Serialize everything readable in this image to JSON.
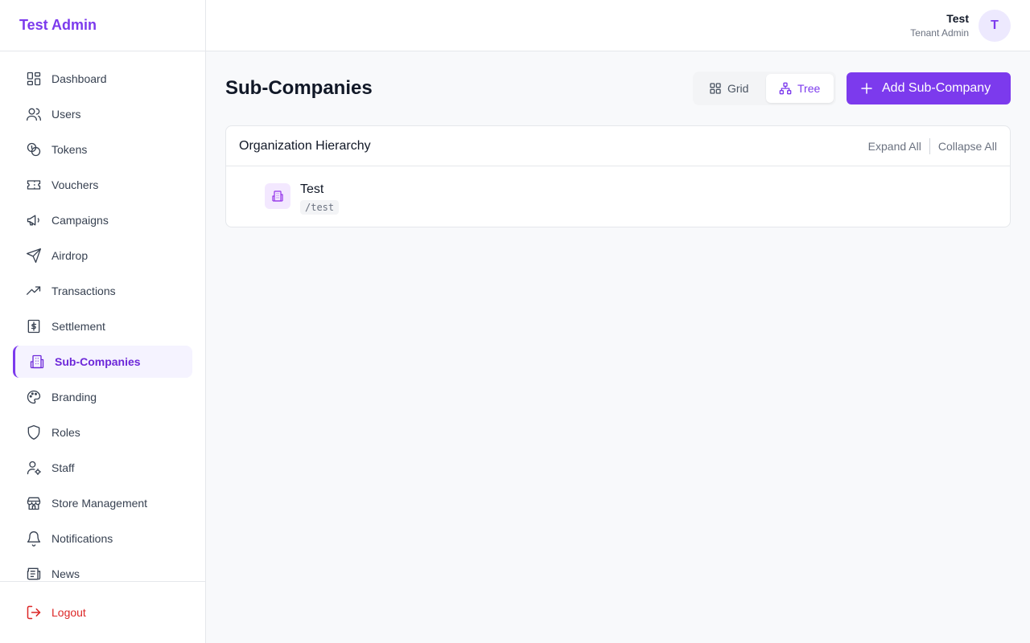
{
  "brand": "Test Admin",
  "sidebar": {
    "items": [
      {
        "label": "Dashboard",
        "icon": "dashboard-icon"
      },
      {
        "label": "Users",
        "icon": "users-icon"
      },
      {
        "label": "Tokens",
        "icon": "coins-icon"
      },
      {
        "label": "Vouchers",
        "icon": "ticket-icon"
      },
      {
        "label": "Campaigns",
        "icon": "megaphone-icon"
      },
      {
        "label": "Airdrop",
        "icon": "send-icon"
      },
      {
        "label": "Transactions",
        "icon": "trending-up-icon"
      },
      {
        "label": "Settlement",
        "icon": "dollar-receipt-icon"
      },
      {
        "label": "Sub-Companies",
        "icon": "building-icon",
        "active": true
      },
      {
        "label": "Branding",
        "icon": "palette-icon"
      },
      {
        "label": "Roles",
        "icon": "shield-icon"
      },
      {
        "label": "Staff",
        "icon": "user-cog-icon"
      },
      {
        "label": "Store Management",
        "icon": "store-icon"
      },
      {
        "label": "Notifications",
        "icon": "bell-icon"
      },
      {
        "label": "News",
        "icon": "newspaper-icon"
      }
    ],
    "logout_label": "Logout"
  },
  "header": {
    "user_name": "Test",
    "user_role": "Tenant Admin",
    "avatar_initial": "T"
  },
  "main": {
    "title": "Sub-Companies",
    "view_toggle": {
      "grid_label": "Grid",
      "tree_label": "Tree",
      "active": "Tree"
    },
    "add_button_label": "Add Sub-Company",
    "card": {
      "title": "Organization Hierarchy",
      "expand_all": "Expand All",
      "collapse_all": "Collapse All",
      "nodes": [
        {
          "name": "Test",
          "path": "/test"
        }
      ]
    }
  },
  "colors": {
    "accent": "#7c3aed",
    "accent_light": "#f5f3ff",
    "logout": "#dc2626"
  }
}
